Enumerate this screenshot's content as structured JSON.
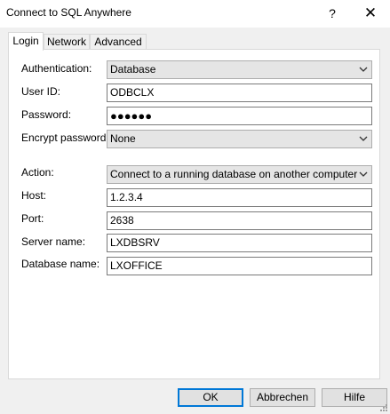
{
  "window": {
    "title": "Connect to SQL Anywhere",
    "help_label": "?",
    "close_label": "✕"
  },
  "tabs": [
    {
      "label": "Login",
      "active": true
    },
    {
      "label": "Network",
      "active": false
    },
    {
      "label": "Advanced",
      "active": false
    }
  ],
  "login": {
    "authentication": {
      "label": "Authentication:",
      "value": "Database"
    },
    "user_id": {
      "label": "User ID:",
      "value": "ODBCLX"
    },
    "password": {
      "label": "Password:",
      "value": "●●●●●●"
    },
    "encrypt_password": {
      "label": "Encrypt password:",
      "value": "None"
    },
    "action": {
      "label": "Action:",
      "value": "Connect to a running database on another computer"
    },
    "host": {
      "label": "Host:",
      "value": "1.2.3.4"
    },
    "port": {
      "label": "Port:",
      "value": "2638"
    },
    "server_name": {
      "label": "Server name:",
      "value": "LXDBSRV"
    },
    "database_name": {
      "label": "Database name:",
      "value": "LXOFFICE"
    }
  },
  "buttons": {
    "ok": "OK",
    "cancel": "Abbrechen",
    "help": "Hilfe"
  },
  "colors": {
    "accent": "#0078d7",
    "panel": "#ffffff",
    "background": "#f0f0f0"
  }
}
